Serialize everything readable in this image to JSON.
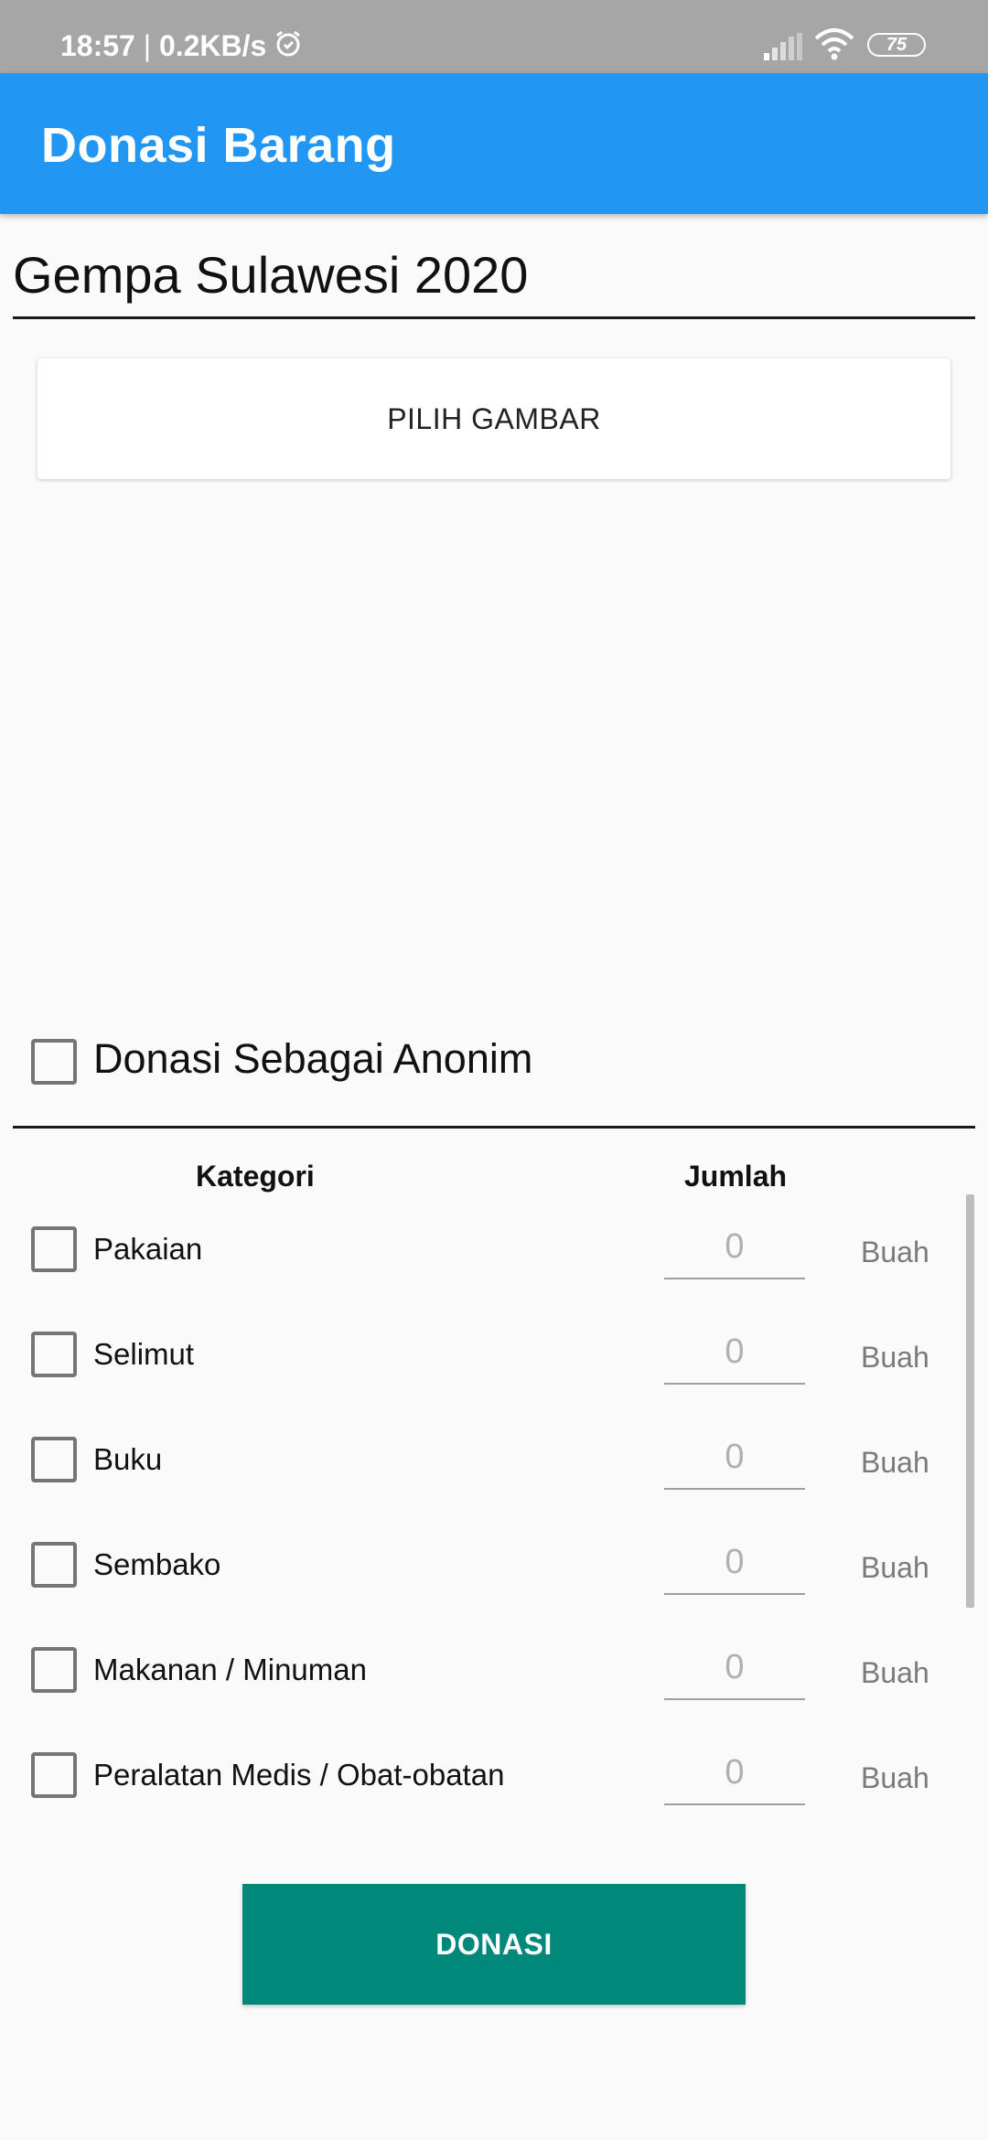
{
  "status_bar": {
    "time": "18:57",
    "speed": "0.2KB/s",
    "battery": "75",
    "icons": [
      "alarm-icon",
      "signal-icon",
      "wifi-icon",
      "battery-icon"
    ]
  },
  "appbar": {
    "title": "Donasi Barang"
  },
  "event": {
    "title": "Gempa Sulawesi 2020"
  },
  "pick_image": {
    "label": "PILIH GAMBAR"
  },
  "anonymous": {
    "label": "Donasi Sebagai Anonim",
    "checked": false
  },
  "table": {
    "headers": {
      "category": "Kategori",
      "amount": "Jumlah"
    },
    "rows": [
      {
        "label": "Pakaian",
        "qty": "0",
        "unit": "Buah"
      },
      {
        "label": "Selimut",
        "qty": "0",
        "unit": "Buah"
      },
      {
        "label": "Buku",
        "qty": "0",
        "unit": "Buah"
      },
      {
        "label": "Sembako",
        "qty": "0",
        "unit": "Buah"
      },
      {
        "label": "Makanan / Minuman",
        "qty": "0",
        "unit": "Buah"
      },
      {
        "label": "Peralatan Medis / Obat-obatan",
        "qty": "0",
        "unit": "Buah"
      }
    ]
  },
  "donate": {
    "label": "DONASI"
  },
  "colors": {
    "appbar": "#2196f3",
    "donate_button": "#00897b",
    "status_bar": "#a6a6a6"
  }
}
